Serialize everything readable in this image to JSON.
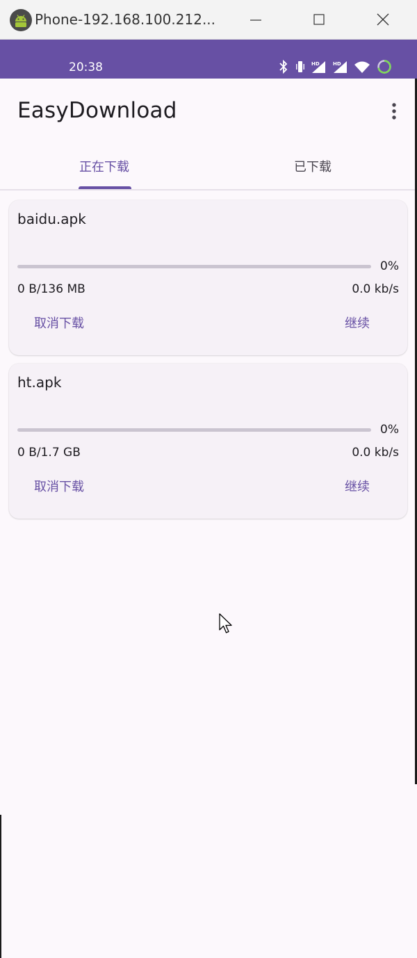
{
  "window": {
    "title": "Phone-192.168.100.212...",
    "icon": "android-icon"
  },
  "status_bar": {
    "time": "20:38",
    "icons": [
      "bluetooth-icon",
      "vibrate-icon",
      "signal-hd-icon",
      "signal-hd-icon",
      "wifi-icon",
      "battery-ring-icon"
    ]
  },
  "app_bar": {
    "title": "EasyDownload"
  },
  "tabs": [
    {
      "label": "正在下载",
      "active": true
    },
    {
      "label": "已下载",
      "active": false
    }
  ],
  "downloads": [
    {
      "filename": "baidu.apk",
      "progress_percent": 0,
      "progress_label": "0%",
      "size_label": "0 B/136 MB",
      "speed_label": "0.0 kb/s",
      "cancel_label": "取消下载",
      "resume_label": "继续"
    },
    {
      "filename": "ht.apk",
      "progress_percent": 0,
      "progress_label": "0%",
      "size_label": "0 B/1.7 GB",
      "speed_label": "0.0 kb/s",
      "cancel_label": "取消下载",
      "resume_label": "继续"
    }
  ],
  "colors": {
    "primary": "#6750a4",
    "background": "#fcf8fc",
    "card": "#f6f1f7",
    "track": "#cac4d0",
    "text": "#1d1b20"
  }
}
